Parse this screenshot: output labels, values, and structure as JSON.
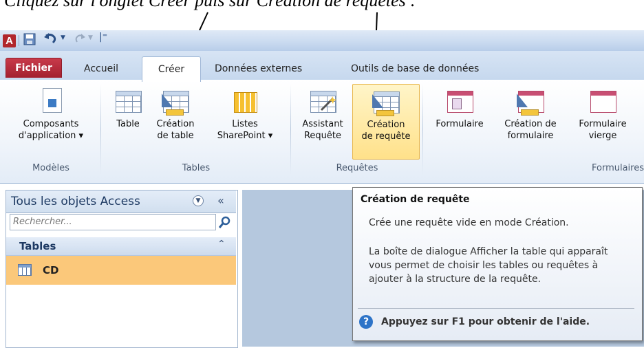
{
  "caption": "Cliquez sur l'onglet Créer puis sur Création de requêtes :",
  "titlebar": {
    "app_icon": "A",
    "icons": [
      "access-app-icon",
      "save-icon",
      "undo-icon",
      "redo-icon"
    ]
  },
  "tabs": {
    "file": "Fichier",
    "home": "Accueil",
    "create": "Créer",
    "external": "Données externes",
    "dbtools": "Outils de base de données"
  },
  "ribbon": {
    "groups": {
      "models": "Modèles",
      "tables": "Tables",
      "queries": "Requêtes",
      "forms": "Formulaires"
    },
    "buttons": {
      "app_parts": {
        "l1": "Composants",
        "l2": "d'application ▾"
      },
      "table": {
        "l1": "Table",
        "l2": ""
      },
      "table_design": {
        "l1": "Création",
        "l2": "de table"
      },
      "sharepoint": {
        "l1": "Listes",
        "l2": "SharePoint ▾"
      },
      "query_wizard": {
        "l1": "Assistant",
        "l2": "Requête"
      },
      "query_design": {
        "l1": "Création",
        "l2": "de requête"
      },
      "form": {
        "l1": "Formulaire",
        "l2": ""
      },
      "form_design": {
        "l1": "Création de",
        "l2": "formulaire"
      },
      "blank_form": {
        "l1": "Formulaire",
        "l2": "vierge"
      }
    }
  },
  "nav": {
    "title": "Tous les objets Access",
    "collapse": "«",
    "search_placeholder": "Rechercher...",
    "group": "Tables",
    "group_chevron": "⌃",
    "items": [
      "CD"
    ]
  },
  "tooltip": {
    "title": "Création de requête",
    "line1": "Crée une requête vide en mode Création.",
    "line2": "La boîte de dialogue Afficher la table qui apparaît vous permet de choisir les tables ou requêtes à ajouter à la structure de la requête.",
    "help": "Appuyez sur F1 pour obtenir de l'aide."
  },
  "colors": {
    "file_tab": "#b02a37",
    "selected_button": "#ffe18a",
    "selected_item": "#fbc87a"
  }
}
